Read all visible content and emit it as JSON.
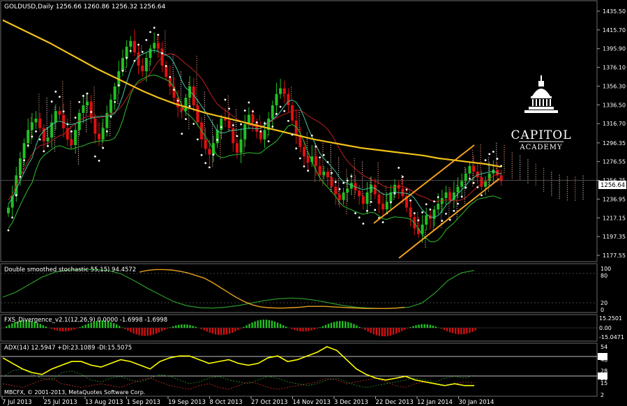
{
  "main": {
    "header": "GOLDUSD,Daily  1256.66 1260.86 1256.32 1256.64",
    "price_tag": "1256.64",
    "price_ticks": [
      "1435.50",
      "1415.70",
      "1395.90",
      "1376.10",
      "1356.30",
      "1336.50",
      "1316.70",
      "1296.35",
      "1276.55",
      "1256.75",
      "1236.95",
      "1217.15",
      "1197.35",
      "1177.55"
    ],
    "ylim": [
      1177.55,
      1435.5
    ]
  },
  "logo": {
    "line1": "CAPITOL",
    "line2": "ACADEMY"
  },
  "stoch": {
    "header": "Double smoothed stochastic 55,15) 94.4572",
    "ticks": [
      "100",
      "80",
      "20",
      "0"
    ]
  },
  "fxs": {
    "header": "FXS_Divergence_v2.1(12,26,9) 0.0000 -1.6998 -1.6998",
    "ticks": [
      "15.2501",
      "0.00",
      "-15.0471"
    ]
  },
  "adx": {
    "header": "ADX(14) 12.5947 +DI:23.1089 -DI:15.5075",
    "ticks": [
      "54",
      "40",
      "28",
      "20",
      "15",
      "2"
    ],
    "copyright": "MBCFX, © 2001-2013, MetaQuotes Software Corp."
  },
  "x_ticks": [
    "7 Jul 2013",
    "25 Jul 2013",
    "13 Aug 2013",
    "1 Sep 2013",
    "19 Sep 2013",
    "8 Oct 2013",
    "27 Oct 2013",
    "14 Nov 2013",
    "3 Dec 2013",
    "22 Dec 2013",
    "12 Jan 2014",
    "30 Jan 2014"
  ],
  "colors": {
    "bull": "#22c022",
    "bear": "#e01010",
    "ma": "#f2c21a",
    "channel": "#f5a020",
    "stoch_a": "#2a9a2a",
    "stoch_b": "#e8a020",
    "adx": "#ffff00"
  },
  "chart_data": [
    {
      "type": "candlestick",
      "title": "GOLDUSD,Daily",
      "ylim": [
        1177.55,
        1435.5
      ],
      "last": {
        "open": 1256.66,
        "high": 1260.86,
        "low": 1256.32,
        "close": 1256.64
      },
      "x_ticks": [
        "7 Jul 2013",
        "25 Jul 2013",
        "13 Aug 2013",
        "1 Sep 2013",
        "19 Sep 2013",
        "8 Oct 2013",
        "27 Oct 2013",
        "14 Nov 2013",
        "3 Dec 2013",
        "22 Dec 2013",
        "12 Jan 2014",
        "30 Jan 2014"
      ],
      "close": [
        1228,
        1240,
        1262,
        1280,
        1296,
        1310,
        1318,
        1322,
        1312,
        1298,
        1302,
        1318,
        1330,
        1326,
        1312,
        1300,
        1294,
        1310,
        1328,
        1336,
        1340,
        1322,
        1306,
        1300,
        1312,
        1328,
        1342,
        1356,
        1372,
        1386,
        1398,
        1404,
        1392,
        1378,
        1372,
        1386,
        1396,
        1402,
        1396,
        1378,
        1366,
        1356,
        1344,
        1334,
        1330,
        1344,
        1356,
        1336,
        1318,
        1300,
        1290,
        1284,
        1296,
        1310,
        1322,
        1320,
        1312,
        1296,
        1286,
        1300,
        1316,
        1326,
        1318,
        1308,
        1300,
        1310,
        1322,
        1336,
        1348,
        1354,
        1348,
        1336,
        1320,
        1304,
        1292,
        1282,
        1276,
        1282,
        1272,
        1262,
        1266,
        1260,
        1250,
        1242,
        1236,
        1244,
        1248,
        1254,
        1246,
        1240,
        1232,
        1244,
        1252,
        1242,
        1232,
        1226,
        1234,
        1244,
        1252,
        1248,
        1240,
        1228,
        1218,
        1206,
        1200,
        1210,
        1220,
        1216,
        1226,
        1232,
        1238,
        1244,
        1236,
        1244,
        1250,
        1256,
        1264,
        1272,
        1266,
        1260,
        1250,
        1256,
        1264,
        1268,
        1262,
        1256
      ],
      "ma": [
        1426,
        1418,
        1410,
        1402,
        1393,
        1384,
        1375,
        1367,
        1359,
        1351,
        1344,
        1338,
        1333,
        1328,
        1324,
        1320,
        1316,
        1312,
        1308,
        1304,
        1300,
        1297,
        1294,
        1291,
        1289,
        1287,
        1285,
        1283,
        1280,
        1278,
        1276,
        1274,
        1271
      ]
    },
    {
      "type": "line",
      "title": "Double smoothed stochastic 55,15)",
      "last": 94.4572,
      "ylim": [
        0,
        100
      ],
      "series": [
        {
          "values": [
            30,
            42,
            60,
            78,
            90,
            95,
            96,
            96,
            94,
            86,
            70,
            52,
            36,
            20,
            10,
            5,
            4,
            6,
            10,
            16,
            22,
            26,
            28,
            26,
            22,
            16,
            10,
            6,
            4,
            3,
            4,
            6,
            16,
            40,
            70,
            88,
            94
          ]
        },
        {
          "values": [
            90,
            94,
            96,
            96,
            95,
            92,
            88,
            82,
            76,
            66,
            54,
            42,
            30,
            20,
            12,
            7,
            5,
            4,
            4,
            5,
            6,
            8,
            8,
            8,
            7,
            6,
            5,
            4,
            3,
            3,
            3,
            3,
            4,
            6
          ]
        }
      ]
    },
    {
      "type": "bar",
      "title": "FXS_Divergence_v2.1(12,26,9)",
      "values_shown": [
        0.0,
        -1.6998,
        -1.6998
      ],
      "ylim": [
        -15.0471,
        15.2501
      ]
    },
    {
      "type": "line",
      "title": "ADX(14)",
      "values_shown": {
        "ADX": 12.5947,
        "+DI": 23.1089,
        "-DI": 15.5075
      },
      "ylim": [
        2,
        54
      ],
      "series": [
        {
          "values": [
            42,
            36,
            30,
            26,
            24,
            30,
            34,
            38,
            38,
            34,
            32,
            36,
            40,
            38,
            34,
            30,
            38,
            42,
            44,
            44,
            40,
            36,
            38,
            40,
            36,
            34,
            36,
            42,
            44,
            38,
            40,
            44,
            48,
            54,
            50,
            40,
            30,
            24,
            20,
            18,
            20,
            22,
            18,
            16,
            14,
            12,
            14,
            12,
            12
          ]
        },
        {
          "values": [
            22,
            28,
            30,
            24,
            20,
            18,
            26,
            28,
            24,
            18,
            16,
            20,
            22,
            18,
            16,
            20,
            24,
            22,
            18,
            14,
            16,
            20,
            22,
            18,
            16,
            14,
            18,
            22,
            20,
            16,
            14,
            12,
            14,
            18,
            20,
            16,
            12,
            10,
            12,
            14,
            16,
            18,
            20,
            18,
            16,
            20,
            22,
            20,
            23
          ]
        },
        {
          "values": [
            14,
            12,
            10,
            14,
            18,
            20,
            14,
            12,
            10,
            12,
            14,
            12,
            10,
            14,
            18,
            20,
            16,
            12,
            10,
            8,
            12,
            14,
            10,
            8,
            12,
            16,
            14,
            10,
            8,
            10,
            12,
            14,
            16,
            20,
            18,
            14,
            16,
            18,
            20,
            16,
            12,
            10,
            14,
            16,
            14,
            12,
            14,
            16,
            15
          ]
        }
      ]
    }
  ]
}
